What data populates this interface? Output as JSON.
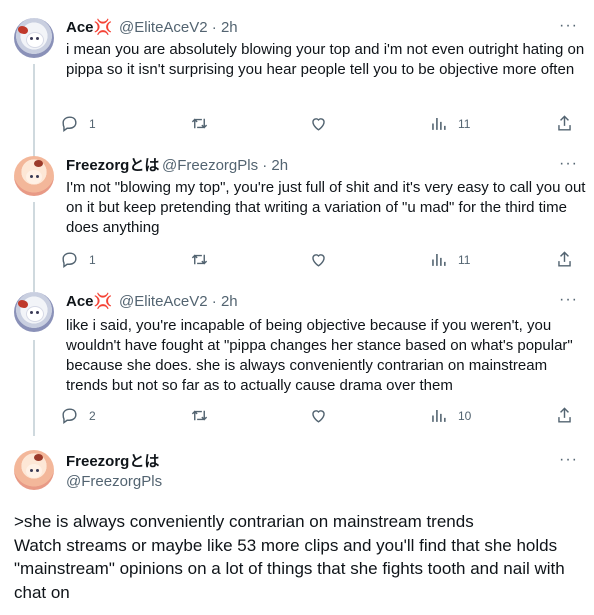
{
  "tweets": [
    {
      "name": "Ace",
      "name_emoji": "💢",
      "handle": "@EliteAceV2",
      "time": "· 2h",
      "text": "i mean you are absolutely blowing your top and i'm not even outright hating on pippa so it isn't surprising you hear people tell you to be objective more often",
      "replies": "1",
      "retweets": "",
      "likes": "",
      "views": "11"
    },
    {
      "name": "Freezorgとは",
      "handle": "@FreezorgPls",
      "time": "· 2h",
      "text": "I'm not \"blowing my top\", you're just full of shit and it's very easy to call you out on it but keep pretending that writing a variation of \"u mad\" for the third time does anything",
      "replies": "1",
      "retweets": "",
      "likes": "",
      "views": "11"
    },
    {
      "name": "Ace",
      "name_emoji": "💢",
      "handle": "@EliteAceV2",
      "time": "· 2h",
      "text": "like i said, you're incapable of being objective because if you weren't, you wouldn't have fought at \"pippa changes her stance based on what's popular\" because she does. she is always conveniently contrarian on mainstream trends but not so far as to actually cause drama over them",
      "replies": "2",
      "retweets": "",
      "likes": "",
      "views": "10"
    }
  ],
  "main": {
    "name": "Freezorgとは",
    "handle": "@FreezorgPls",
    "text": ">she is always conveniently contrarian on mainstream trends\nWatch streams or maybe like 53 more clips and you'll find that she holds \"mainstream\" opinions on a lot of things that she fights tooth and nail with chat on"
  },
  "colors": {
    "text": "#0f1419",
    "muted": "#536471",
    "line": "#cfd9de"
  },
  "icons": [
    "reply-icon",
    "retweet-icon",
    "like-icon",
    "views-icon",
    "share-icon",
    "more-icon"
  ]
}
